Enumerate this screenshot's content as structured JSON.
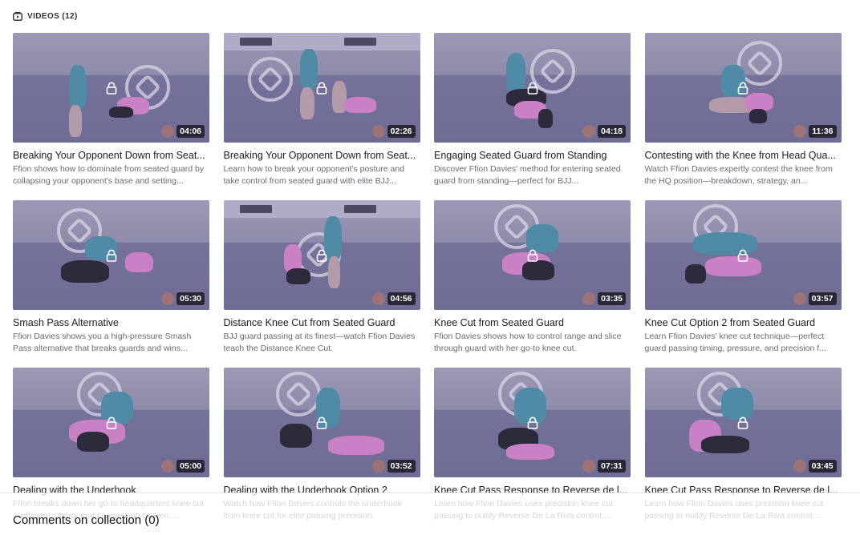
{
  "section": {
    "title": "VIDEOS (12)",
    "icon": "video-library-icon"
  },
  "videos": [
    {
      "title": "Breaking Your Opponent Down from Seat...",
      "description": "Ffion shows how to dominate from seated guard by collapsing your opponent's base and setting...",
      "duration": "04:06"
    },
    {
      "title": "Breaking Your Opponent Down from Seat...",
      "description": "Learn how to break your opponent's posture and take control from seated guard with elite BJJ...",
      "duration": "02:26"
    },
    {
      "title": "Engaging Seated Guard from Standing",
      "description": "Discover Ffion Davies' method for entering seated guard from standing—perfect for BJJ...",
      "duration": "04:18"
    },
    {
      "title": "Contesting with the Knee from Head Qua...",
      "description": "Watch Ffion Davies expertly contest the knee from the HQ position—breakdown, strategy, an...",
      "duration": "11:36"
    },
    {
      "title": "Smash Pass Alternative",
      "description": "Ffion Davies shows you a high-pressure Smash Pass alternative that breaks guards and wins...",
      "duration": "05:30"
    },
    {
      "title": "Distance Knee Cut from Seated Guard",
      "description": "BJJ guard passing at its finest—watch Ffion Davies teach the Distance Knee Cut.",
      "duration": "04:56"
    },
    {
      "title": "Knee Cut from Seated Guard",
      "description": "Ffion Davies shows how to control range and slice through guard with her go-to knee cut.",
      "duration": "03:35"
    },
    {
      "title": "Knee Cut Option 2 from Seated Guard",
      "description": "Learn Ffion Davies' knee cut technique—perfect guard passing timing, pressure, and precision f...",
      "duration": "03:57"
    },
    {
      "title": "Dealing with the Underhook",
      "description": "Ffion breaks down her go-to headquarters knee cut—efficient, sharp, and competition-proven....",
      "duration": "05:00"
    },
    {
      "title": "Dealing with the Underhook Option 2",
      "description": "Watch how Ffion Davies controls the underhook from knee cut for elite passing precision.",
      "duration": "03:52"
    },
    {
      "title": "Knee Cut Pass Response to Reverse de l...",
      "description": "Learn how Ffion Davies uses precision knee cut passing to nullify Reverse De La Riva control....",
      "duration": "07:31"
    },
    {
      "title": "Knee Cut Pass Response to Reverse de l...",
      "description": "Learn how Ffion Davies uses precision knee cut passing to nullify Reverse De La Riva control....",
      "duration": "03:45"
    }
  ],
  "comments": {
    "title": "Comments on collection (0)"
  },
  "colors": {
    "thumbnail_overlay": "#8e8cab",
    "duration_badge": "#1e1e28",
    "description_text": "#6b6b73"
  }
}
